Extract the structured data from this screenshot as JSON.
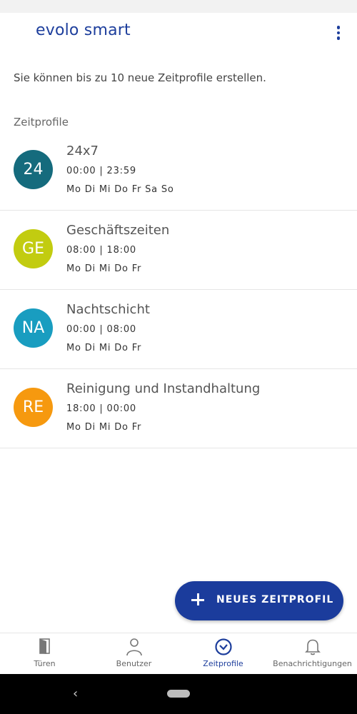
{
  "app": {
    "title": "evolo smart",
    "menu_icon": "more-vert-icon"
  },
  "info_text": "Sie können bis zu 10 neue Zeitprofile erstellen.",
  "section_label": "Zeitprofile",
  "profiles": [
    {
      "initials": "24",
      "name": "24x7",
      "time": "00:00 | 23:59",
      "days": "Mo Di Mi Do Fr Sa So",
      "color": "#156b7d"
    },
    {
      "initials": "GE",
      "name": "Geschäftszeiten",
      "time": "08:00 | 18:00",
      "days": "Mo Di Mi Do Fr",
      "color": "#c2cc10"
    },
    {
      "initials": "NA",
      "name": "Nachtschicht",
      "time": "00:00 | 08:00",
      "days": "Mo Di Mi Do Fr",
      "color": "#199dc0"
    },
    {
      "initials": "RE",
      "name": "Reinigung und Instandhaltung",
      "time": "18:00 | 00:00",
      "days": "Mo Di Mi Do Fr",
      "color": "#f6990f"
    }
  ],
  "fab": {
    "label": "NEUES ZEITPROFIL",
    "icon": "plus-icon"
  },
  "bottom_nav": {
    "active": "Zeitprofile",
    "items": [
      {
        "label": "Türen",
        "icon": "door-icon"
      },
      {
        "label": "Benutzer",
        "icon": "person-icon"
      },
      {
        "label": "Zeitprofile",
        "icon": "clock-icon"
      },
      {
        "label": "Benachrichtigungen",
        "icon": "bell-icon"
      }
    ]
  },
  "colors": {
    "brand": "#1d3e9c",
    "divider": "#e6e6e6"
  }
}
